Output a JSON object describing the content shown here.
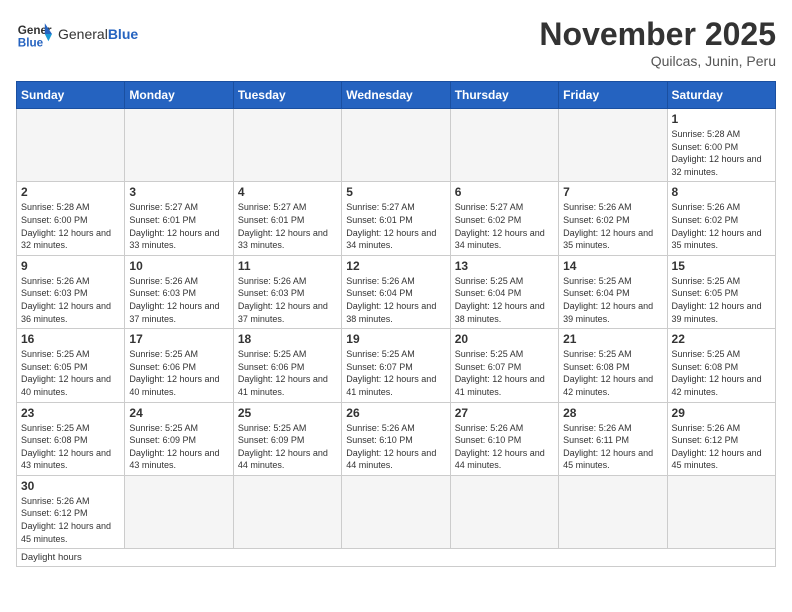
{
  "header": {
    "logo_general": "General",
    "logo_blue": "Blue",
    "month_title": "November 2025",
    "location": "Quilcas, Junin, Peru"
  },
  "days_of_week": [
    "Sunday",
    "Monday",
    "Tuesday",
    "Wednesday",
    "Thursday",
    "Friday",
    "Saturday"
  ],
  "weeks": [
    [
      {
        "day": "",
        "empty": true
      },
      {
        "day": "",
        "empty": true
      },
      {
        "day": "",
        "empty": true
      },
      {
        "day": "",
        "empty": true
      },
      {
        "day": "",
        "empty": true
      },
      {
        "day": "",
        "empty": true
      },
      {
        "day": "1",
        "sunrise": "5:28 AM",
        "sunset": "6:00 PM",
        "daylight": "12 hours and 32 minutes."
      }
    ],
    [
      {
        "day": "2",
        "sunrise": "5:28 AM",
        "sunset": "6:00 PM",
        "daylight": "12 hours and 32 minutes."
      },
      {
        "day": "3",
        "sunrise": "5:27 AM",
        "sunset": "6:01 PM",
        "daylight": "12 hours and 33 minutes."
      },
      {
        "day": "4",
        "sunrise": "5:27 AM",
        "sunset": "6:01 PM",
        "daylight": "12 hours and 33 minutes."
      },
      {
        "day": "5",
        "sunrise": "5:27 AM",
        "sunset": "6:01 PM",
        "daylight": "12 hours and 34 minutes."
      },
      {
        "day": "6",
        "sunrise": "5:27 AM",
        "sunset": "6:02 PM",
        "daylight": "12 hours and 34 minutes."
      },
      {
        "day": "7",
        "sunrise": "5:26 AM",
        "sunset": "6:02 PM",
        "daylight": "12 hours and 35 minutes."
      },
      {
        "day": "8",
        "sunrise": "5:26 AM",
        "sunset": "6:02 PM",
        "daylight": "12 hours and 35 minutes."
      }
    ],
    [
      {
        "day": "9",
        "sunrise": "5:26 AM",
        "sunset": "6:03 PM",
        "daylight": "12 hours and 36 minutes."
      },
      {
        "day": "10",
        "sunrise": "5:26 AM",
        "sunset": "6:03 PM",
        "daylight": "12 hours and 37 minutes."
      },
      {
        "day": "11",
        "sunrise": "5:26 AM",
        "sunset": "6:03 PM",
        "daylight": "12 hours and 37 minutes."
      },
      {
        "day": "12",
        "sunrise": "5:26 AM",
        "sunset": "6:04 PM",
        "daylight": "12 hours and 38 minutes."
      },
      {
        "day": "13",
        "sunrise": "5:25 AM",
        "sunset": "6:04 PM",
        "daylight": "12 hours and 38 minutes."
      },
      {
        "day": "14",
        "sunrise": "5:25 AM",
        "sunset": "6:04 PM",
        "daylight": "12 hours and 39 minutes."
      },
      {
        "day": "15",
        "sunrise": "5:25 AM",
        "sunset": "6:05 PM",
        "daylight": "12 hours and 39 minutes."
      }
    ],
    [
      {
        "day": "16",
        "sunrise": "5:25 AM",
        "sunset": "6:05 PM",
        "daylight": "12 hours and 40 minutes."
      },
      {
        "day": "17",
        "sunrise": "5:25 AM",
        "sunset": "6:06 PM",
        "daylight": "12 hours and 40 minutes."
      },
      {
        "day": "18",
        "sunrise": "5:25 AM",
        "sunset": "6:06 PM",
        "daylight": "12 hours and 41 minutes."
      },
      {
        "day": "19",
        "sunrise": "5:25 AM",
        "sunset": "6:07 PM",
        "daylight": "12 hours and 41 minutes."
      },
      {
        "day": "20",
        "sunrise": "5:25 AM",
        "sunset": "6:07 PM",
        "daylight": "12 hours and 41 minutes."
      },
      {
        "day": "21",
        "sunrise": "5:25 AM",
        "sunset": "6:08 PM",
        "daylight": "12 hours and 42 minutes."
      },
      {
        "day": "22",
        "sunrise": "5:25 AM",
        "sunset": "6:08 PM",
        "daylight": "12 hours and 42 minutes."
      }
    ],
    [
      {
        "day": "23",
        "sunrise": "5:25 AM",
        "sunset": "6:08 PM",
        "daylight": "12 hours and 43 minutes."
      },
      {
        "day": "24",
        "sunrise": "5:25 AM",
        "sunset": "6:09 PM",
        "daylight": "12 hours and 43 minutes."
      },
      {
        "day": "25",
        "sunrise": "5:25 AM",
        "sunset": "6:09 PM",
        "daylight": "12 hours and 44 minutes."
      },
      {
        "day": "26",
        "sunrise": "5:26 AM",
        "sunset": "6:10 PM",
        "daylight": "12 hours and 44 minutes."
      },
      {
        "day": "27",
        "sunrise": "5:26 AM",
        "sunset": "6:10 PM",
        "daylight": "12 hours and 44 minutes."
      },
      {
        "day": "28",
        "sunrise": "5:26 AM",
        "sunset": "6:11 PM",
        "daylight": "12 hours and 45 minutes."
      },
      {
        "day": "29",
        "sunrise": "5:26 AM",
        "sunset": "6:12 PM",
        "daylight": "12 hours and 45 minutes."
      }
    ],
    [
      {
        "day": "30",
        "sunrise": "5:26 AM",
        "sunset": "6:12 PM",
        "daylight": "12 hours and 45 minutes."
      },
      {
        "day": "",
        "empty": true
      },
      {
        "day": "",
        "empty": true
      },
      {
        "day": "",
        "empty": true
      },
      {
        "day": "",
        "empty": true
      },
      {
        "day": "",
        "empty": true
      },
      {
        "day": "",
        "empty": true
      }
    ]
  ],
  "footer": {
    "daylight_label": "Daylight hours"
  }
}
